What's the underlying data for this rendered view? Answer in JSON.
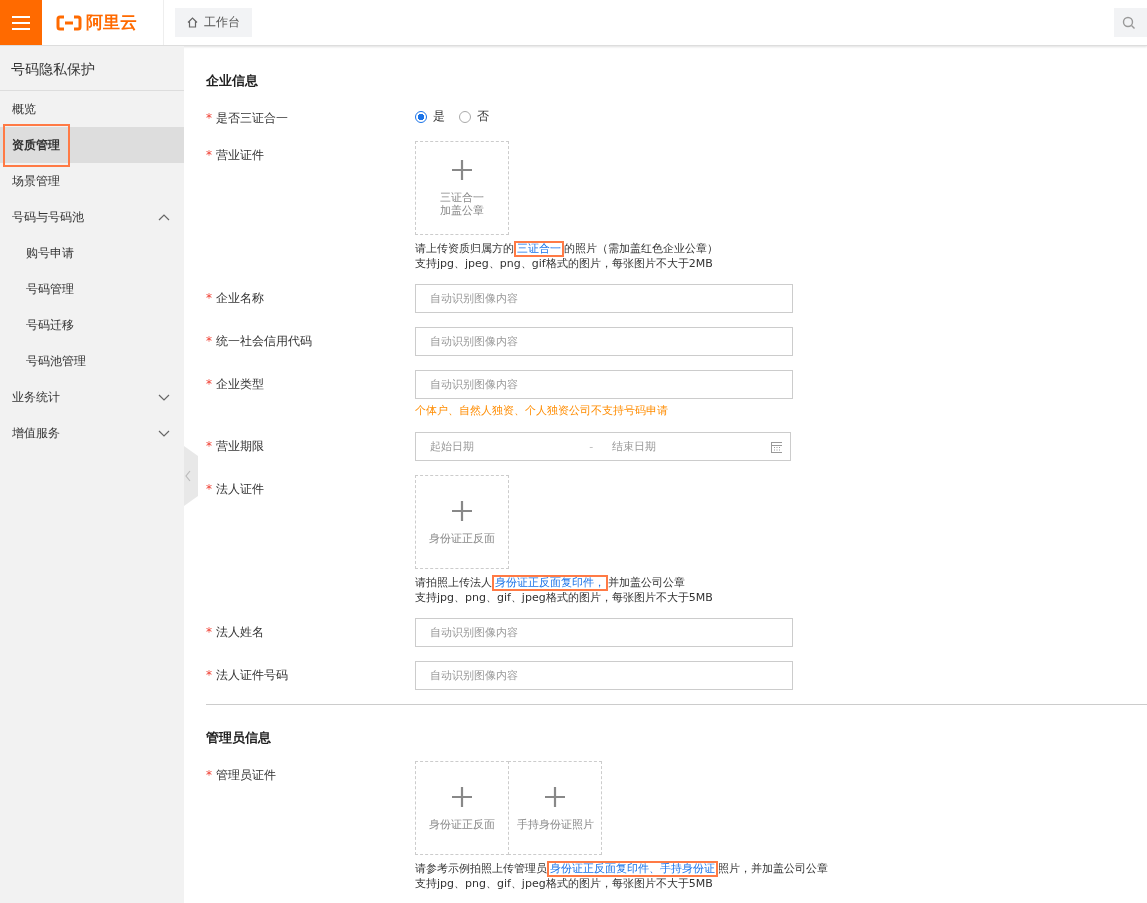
{
  "header": {
    "logo": "阿里云",
    "tabs": [
      {
        "label": "工作台",
        "selected": true
      }
    ]
  },
  "sidebar": {
    "title": "号码隐私保护",
    "items": [
      {
        "label": "概览",
        "selected": false,
        "annotated": false
      },
      {
        "label": "资质管理",
        "selected": true,
        "annotated": true
      },
      {
        "label": "场景管理",
        "selected": false,
        "annotated": false
      },
      {
        "label": "号码与号码池",
        "selected": false,
        "annotated": false,
        "expanded": true,
        "children": [
          {
            "label": "购号申请",
            "selected": false,
            "annotated": false
          },
          {
            "label": "号码管理",
            "selected": false,
            "annotated": false
          },
          {
            "label": "号码迁移",
            "selected": false,
            "annotated": false
          },
          {
            "label": "号码池管理",
            "selected": false,
            "annotated": false
          }
        ]
      },
      {
        "label": "业务统计",
        "selected": false,
        "annotated": false,
        "expanded": false
      },
      {
        "label": "增值服务",
        "selected": false,
        "annotated": false,
        "expanded": false
      }
    ]
  },
  "sections": [
    {
      "title": "企业信息",
      "fields": [
        {
          "kind": "radio",
          "label": "是否三证合一",
          "required_mark": "*",
          "options": [
            {
              "label": "是",
              "selected": true
            },
            {
              "label": "否",
              "selected": false
            }
          ]
        },
        {
          "kind": "upload",
          "label": "营业证件",
          "required_mark": "*",
          "tiles": [
            {
              "caption_lines": [
                "三证合一",
                "加盖公章"
              ]
            }
          ],
          "hint": [
            {
              "text": "请上传资质归属方的",
              "link": false,
              "annotated": false
            },
            {
              "text": "三证合一",
              "link": true,
              "annotated": true
            },
            {
              "text": "的照片（需加盖红色企业公章）",
              "link": false,
              "annotated": false
            }
          ],
          "note": "支持jpg、jpeg、png、gif格式的图片，每张图片不大于2MB"
        },
        {
          "kind": "input",
          "label": "企业名称",
          "required_mark": "*",
          "placeholder": "自动识别图像内容"
        },
        {
          "kind": "input",
          "label": "统一社会信用代码",
          "required_mark": "*",
          "placeholder": "自动识别图像内容"
        },
        {
          "kind": "input",
          "label": "企业类型",
          "required_mark": "*",
          "placeholder": "自动识别图像内容",
          "warning": "个体户、自然人独资、个人独资公司不支持号码申请"
        },
        {
          "kind": "date-range",
          "label": "营业期限",
          "required_mark": "*",
          "start_placeholder": "起始日期",
          "separator": "-",
          "end_placeholder": "结束日期"
        },
        {
          "kind": "upload",
          "label": "法人证件",
          "required_mark": "*",
          "tiles": [
            {
              "caption_lines": [
                "身份证正反面"
              ]
            }
          ],
          "hint": [
            {
              "text": "请拍照上传法人",
              "link": false,
              "annotated": false
            },
            {
              "text": "身份证正反面复印件，",
              "link": true,
              "annotated": true
            },
            {
              "text": "并加盖公司公章",
              "link": false,
              "annotated": false
            }
          ],
          "note": "支持jpg、png、gif、jpeg格式的图片，每张图片不大于5MB"
        },
        {
          "kind": "input",
          "label": "法人姓名",
          "required_mark": "*",
          "placeholder": "自动识别图像内容"
        },
        {
          "kind": "input",
          "label": "法人证件号码",
          "required_mark": "*",
          "placeholder": "自动识别图像内容"
        }
      ]
    },
    {
      "title": "管理员信息",
      "fields": [
        {
          "kind": "upload",
          "label": "管理员证件",
          "required_mark": "*",
          "tiles": [
            {
              "caption_lines": [
                "身份证正反面"
              ]
            },
            {
              "caption_lines": [
                "手持身份证照片"
              ]
            }
          ],
          "hint": [
            {
              "text": "请参考示例拍照上传管理员",
              "link": false,
              "annotated": false
            },
            {
              "text": "身份证正反面复印件、手持身份证",
              "link": true,
              "annotated": true
            },
            {
              "text": "照片，并加盖公司公章",
              "link": false,
              "annotated": false
            }
          ],
          "note": "支持jpg、png、gif、jpeg格式的图片，每张图片不大于5MB"
        }
      ]
    }
  ]
}
